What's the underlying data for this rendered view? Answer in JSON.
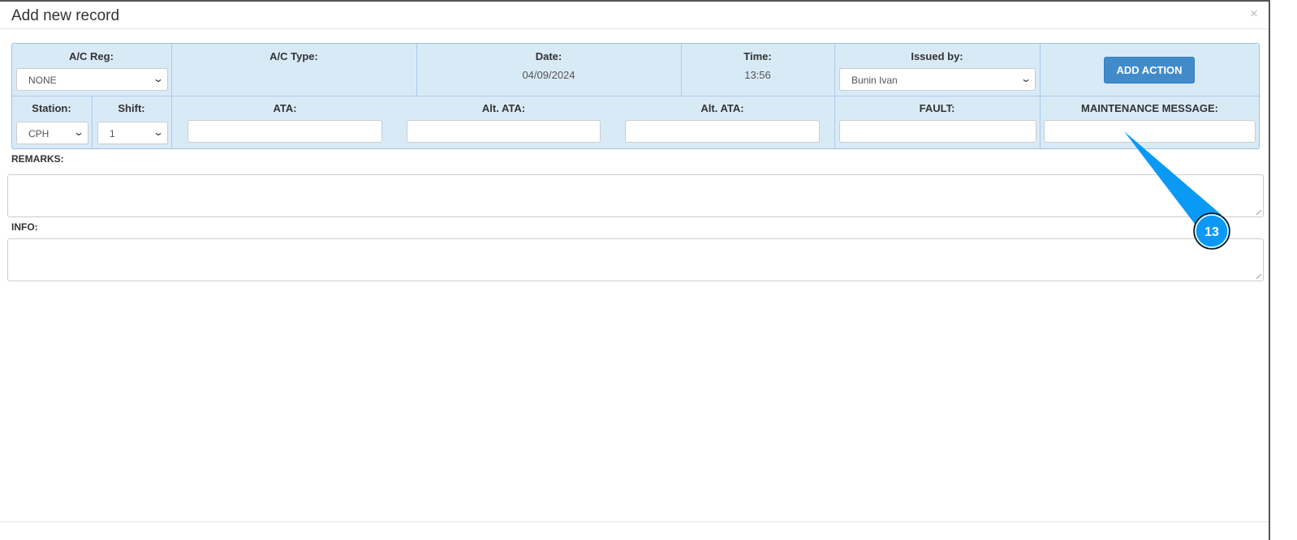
{
  "dialog": {
    "title": "Add new record",
    "close": "×"
  },
  "row1": {
    "ac_reg": {
      "label": "A/C Reg:",
      "value": "NONE"
    },
    "ac_type": {
      "label": "A/C Type:"
    },
    "date": {
      "label": "Date:",
      "value": "04/09/2024"
    },
    "time": {
      "label": "Time:",
      "value": "13:56"
    },
    "issued_by": {
      "label": "Issued by:",
      "value": "Bunin Ivan"
    },
    "add_action": "ADD ACTION"
  },
  "row2": {
    "station": {
      "label": "Station:",
      "value": "CPH"
    },
    "shift": {
      "label": "Shift:",
      "value": "1"
    },
    "ata": {
      "label": "ATA:"
    },
    "alt_ata1": {
      "label": "Alt. ATA:"
    },
    "alt_ata2": {
      "label": "Alt. ATA:"
    },
    "fault": {
      "label": "FAULT:"
    },
    "maintenance_message": {
      "label": "MAINTENANCE MESSAGE:"
    }
  },
  "remarks": {
    "label": "REMARKS:"
  },
  "info": {
    "label": "INFO:"
  },
  "callout": {
    "number": "13",
    "color": "#0a99f5"
  }
}
